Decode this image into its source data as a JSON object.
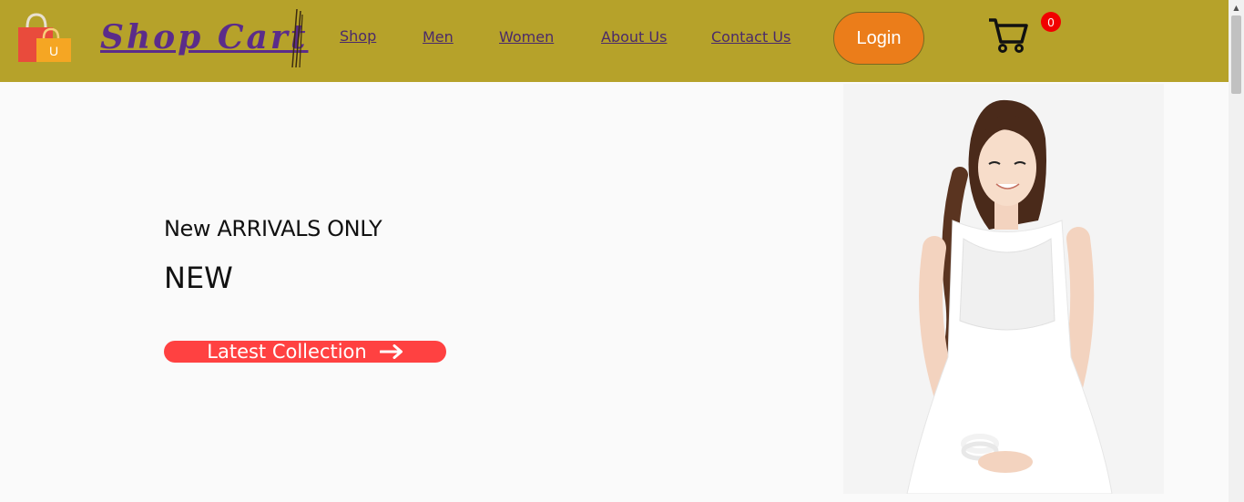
{
  "brand": {
    "name": "Shop Cart",
    "bag_letter": "U"
  },
  "nav": {
    "items": [
      {
        "label": "Shop"
      },
      {
        "label": "Men"
      },
      {
        "label": "Women"
      },
      {
        "label": "About Us"
      },
      {
        "label": "Contact Us"
      }
    ],
    "login_label": "Login",
    "cart_count": "0"
  },
  "hero": {
    "subtitle": "New ARRIVALS ONLY",
    "title": "NEW",
    "button_label": "Latest Collection"
  },
  "colors": {
    "navbar": "#b6a22a",
    "brand_text": "#5b2c8a",
    "login_bg": "#eb7d1a",
    "cta_bg": "#ff4141",
    "badge_bg": "#f10000"
  },
  "icons": [
    "shopping-bag-logo-icon",
    "cart-icon",
    "arrow-right-icon"
  ]
}
